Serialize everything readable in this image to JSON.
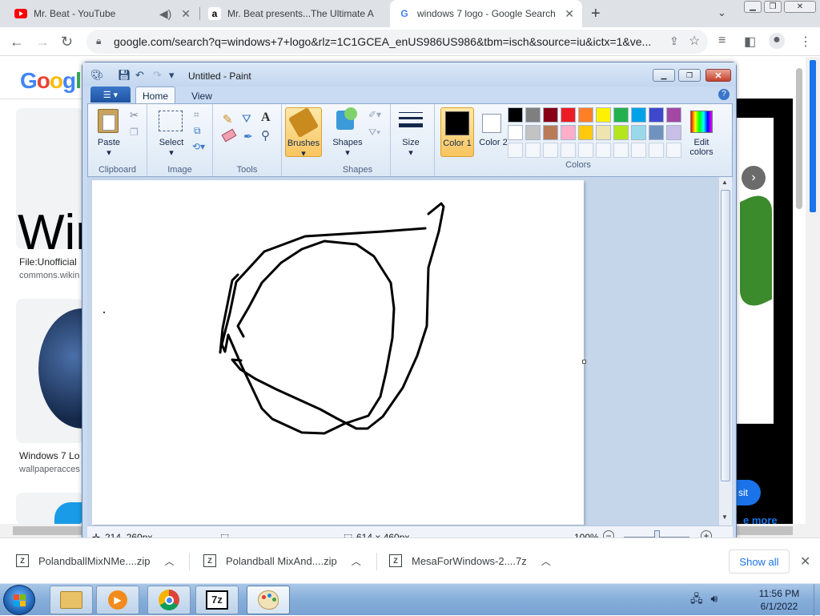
{
  "tabs": [
    {
      "title": "Mr. Beat - YouTube",
      "favicon": "youtube-icon"
    },
    {
      "title": "Mr. Beat presents...The Ultimate A",
      "favicon": "amazon-icon"
    },
    {
      "title": "windows 7 logo - Google Search",
      "favicon": "google-icon"
    }
  ],
  "omnibox": {
    "url": "google.com/search?q=windows+7+logo&rlz=1C1GCEA_enUS986US986&tbm=isch&source=iu&ictx=1&ve..."
  },
  "google": {
    "logo": "Google",
    "big_text": "Win",
    "result1_title": "File:Unofficial",
    "result1_source": "commons.wikin",
    "result2_title": "Windows 7 Lo",
    "result2_source": "wallpaperacces",
    "visit_label": "sit",
    "more_label": "e more"
  },
  "paint": {
    "title": "Untitled - Paint",
    "tabs": {
      "home": "Home",
      "view": "View"
    },
    "groups": {
      "clipboard": "Clipboard",
      "image": "Image",
      "tools": "Tools",
      "shapes": "Shapes",
      "colors": "Colors"
    },
    "buttons": {
      "paste": "Paste",
      "select": "Select",
      "brushes": "Brushes",
      "shapes": "Shapes",
      "size": "Size",
      "color1": "Color 1",
      "color2": "Color 2",
      "edit_colors": "Edit colors"
    },
    "palette": [
      "#000000",
      "#7f7f7f",
      "#880015",
      "#ed1c24",
      "#ff7f27",
      "#fff200",
      "#22b14c",
      "#00a2e8",
      "#3f48cc",
      "#a349a4",
      "#ffffff",
      "#c3c3c3",
      "#b97a57",
      "#ffaec9",
      "#ffc90e",
      "#efe4b0",
      "#b5e61d",
      "#99d9ea",
      "#7092be",
      "#c8bfe7"
    ],
    "color1_value": "#000000",
    "color2_value": "#ffffff",
    "status": {
      "cursor": "214, 260px",
      "size": "614 × 460px",
      "zoom": "100%"
    }
  },
  "downloads": [
    {
      "name": "PolandballMixNMe....zip"
    },
    {
      "name": "Polandball MixAnd....zip"
    },
    {
      "name": "MesaForWindows-2....7z"
    }
  ],
  "shelf": {
    "show_all": "Show all"
  },
  "clock": {
    "time": "11:56 PM",
    "date": "6/1/2022"
  }
}
